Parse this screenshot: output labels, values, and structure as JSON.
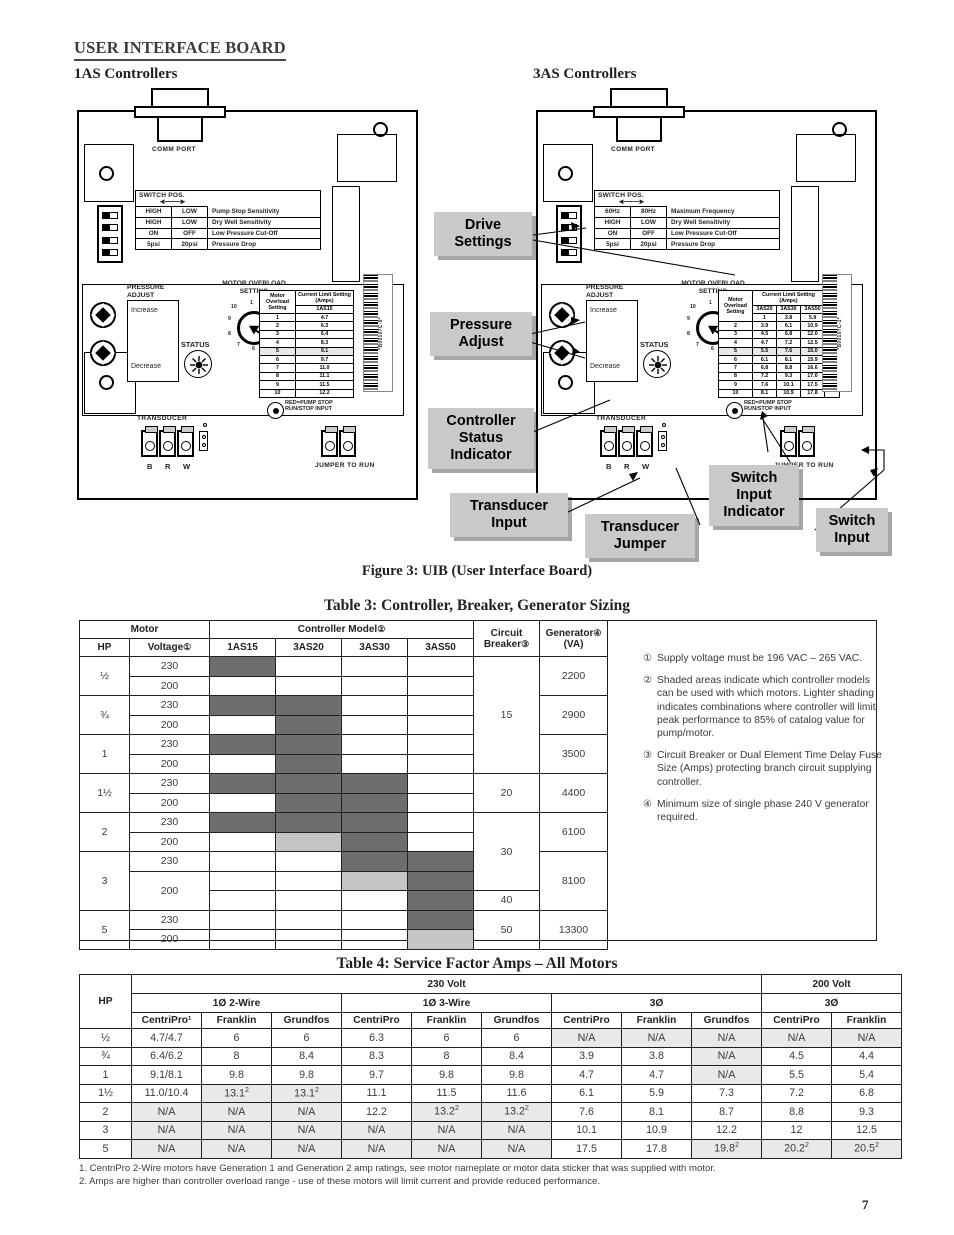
{
  "section": {
    "title": "USER INTERFACE BOARD"
  },
  "boards": {
    "left": {
      "title": "1AS Controllers",
      "comm_port": "COMM PORT",
      "switch_pos_header": "SWITCH POS.",
      "switch_rows": [
        {
          "pos_a": "HIGH",
          "pos_b": "LOW",
          "function": "Pump Stop Sensitivity"
        },
        {
          "pos_a": "HIGH",
          "pos_b": "LOW",
          "function": "Dry Well Sensitivity"
        },
        {
          "pos_a": "ON",
          "pos_b": "OFF",
          "function": "Low Pressure Cut-Off"
        },
        {
          "pos_a": "5psi",
          "pos_b": "20psi",
          "function": "Pressure Drop"
        }
      ],
      "pressure_adjust_label": "PRESSURE ADJUST",
      "increase": "Increase",
      "decrease": "Decrease",
      "status_label": "STATUS",
      "motor_overload_label": "MOTOR OVERLOAD SETTING",
      "dial_numbers": [
        "1",
        "2",
        "3",
        "4",
        "5",
        "6",
        "7",
        "8",
        "9",
        "10"
      ],
      "overload_table": {
        "col1_header": "Motor Overload Setting",
        "col2_header": "Current Limit Setting (Amps)",
        "models": [
          "1AS15"
        ],
        "rows": [
          {
            "setting": "1",
            "values": [
              "4.7"
            ]
          },
          {
            "setting": "2",
            "values": [
              "6.3"
            ]
          },
          {
            "setting": "3",
            "values": [
              "6.4"
            ]
          },
          {
            "setting": "4",
            "values": [
              "8.3"
            ]
          },
          {
            "setting": "5",
            "values": [
              "9.1"
            ]
          },
          {
            "setting": "6",
            "values": [
              "9.7"
            ]
          },
          {
            "setting": "7",
            "values": [
              "11.0"
            ]
          },
          {
            "setting": "8",
            "values": [
              "11.1"
            ]
          },
          {
            "setting": "9",
            "values": [
              "11.5"
            ]
          },
          {
            "setting": "10",
            "values": [
              "12.2"
            ]
          }
        ]
      },
      "barcode_text": "*B00107C-5*",
      "transducer_label": "TRANSDUCER",
      "terminals": [
        "B",
        "R",
        "W"
      ],
      "red_led_text_1": "RED=PUMP STOP",
      "red_led_text_2": "RUN/STOP INPUT",
      "jumper_label": "JUMPER TO RUN"
    },
    "right": {
      "title": "3AS Controllers",
      "comm_port": "COMM PORT",
      "switch_pos_header": "SWITCH POS.",
      "switch_rows": [
        {
          "pos_a": "60Hz",
          "pos_b": "80Hz",
          "function": "Maximum Frequency"
        },
        {
          "pos_a": "HIGH",
          "pos_b": "LOW",
          "function": "Dry Well Sensitivity"
        },
        {
          "pos_a": "ON",
          "pos_b": "OFF",
          "function": "Low Pressure Cut-Off"
        },
        {
          "pos_a": "5psi",
          "pos_b": "20psi",
          "function": "Pressure Drop"
        }
      ],
      "pressure_adjust_label": "PRESSURE ADJUST",
      "increase": "Increase",
      "decrease": "Decrease",
      "status_label": "STATUS",
      "motor_overload_label": "MOTOR OVERLOAD SETTING",
      "dial_numbers": [
        "1",
        "2",
        "3",
        "4",
        "5",
        "6",
        "7",
        "8",
        "9",
        "10"
      ],
      "overload_table": {
        "col1_header": "Motor Overload Setting",
        "col2_header": "Current Limit Setting (Amps)",
        "models": [
          "3AS20",
          "3AS30",
          "3AS50"
        ],
        "rows": [
          {
            "setting": "1",
            "values": [
              "3.8",
              "5.9",
              "10.1"
            ]
          },
          {
            "setting": "2",
            "values": [
              "3.9",
              "6.1",
              "10.9"
            ]
          },
          {
            "setting": "3",
            "values": [
              "4.5",
              "6.8",
              "12.0"
            ]
          },
          {
            "setting": "4",
            "values": [
              "4.7",
              "7.2",
              "12.5"
            ]
          },
          {
            "setting": "5",
            "values": [
              "5.5",
              "7.6",
              "15.0"
            ]
          },
          {
            "setting": "6",
            "values": [
              "6.1",
              "8.1",
              "15.9"
            ]
          },
          {
            "setting": "7",
            "values": [
              "6.8",
              "8.8",
              "16.6"
            ]
          },
          {
            "setting": "8",
            "values": [
              "7.2",
              "9.3",
              "17.0"
            ]
          },
          {
            "setting": "9",
            "values": [
              "7.6",
              "10.1",
              "17.5"
            ]
          },
          {
            "setting": "10",
            "values": [
              "8.1",
              "10.9",
              "17.8"
            ]
          }
        ]
      },
      "barcode_text": "*B00107C-1*",
      "transducer_label": "TRANSDUCER",
      "terminals": [
        "B",
        "R",
        "W"
      ],
      "red_led_text_1": "RED=PUMP STOP",
      "red_led_text_2": "RUN/STOP INPUT",
      "jumper_label": "JUMPER TO RUN"
    }
  },
  "callouts": {
    "drive_settings": "Drive\nSettings",
    "pressure_adjust": "Pressure\nAdjust",
    "controller_status_indicator": "Controller\nStatus\nIndicator",
    "transducer_input": "Transducer\nInput",
    "transducer_jumper": "Transducer\nJumper",
    "switch_input_indicator": "Switch\nInput\nIndicator",
    "switch_input": "Switch\nInput"
  },
  "figure_caption": "Figure 3: UIB (User Interface Board)",
  "table3": {
    "title": "Table 3: Controller, Breaker, Generator Sizing",
    "group_headers": {
      "motor": "Motor",
      "controller_model": "Controller Model",
      "controller_model_note": "②",
      "circuit_breaker": "Circuit Breaker",
      "circuit_breaker_note": "③",
      "generator": "Generator",
      "generator_note": "④",
      "generator_unit": "(VA)"
    },
    "sub_headers": {
      "hp": "HP",
      "voltage": "Voltage",
      "voltage_note": "①",
      "models": [
        "1AS15",
        "3AS20",
        "3AS30",
        "3AS50"
      ]
    },
    "rows": [
      {
        "hp": "½",
        "voltage": "230",
        "shading": [
          "dark",
          "none",
          "none",
          "none"
        ],
        "breaker": "15",
        "generator": "2200"
      },
      {
        "hp": "½",
        "voltage": "200",
        "shading": [
          "none",
          "none",
          "none",
          "none"
        ],
        "breaker": "",
        "generator": "2200"
      },
      {
        "hp": "¾",
        "voltage": "230",
        "shading": [
          "dark",
          "dark",
          "none",
          "none"
        ],
        "breaker": "15",
        "generator": "2900"
      },
      {
        "hp": "¾",
        "voltage": "200",
        "shading": [
          "none",
          "dark",
          "none",
          "none"
        ],
        "breaker": "",
        "generator": "2900"
      },
      {
        "hp": "1",
        "voltage": "230",
        "shading": [
          "dark",
          "dark",
          "none",
          "none"
        ],
        "breaker": "",
        "generator": "3500"
      },
      {
        "hp": "1",
        "voltage": "200",
        "shading": [
          "none",
          "dark",
          "none",
          "none"
        ],
        "breaker": "",
        "generator": "3500"
      },
      {
        "hp": "1½",
        "voltage": "230",
        "shading": [
          "dark",
          "dark",
          "dark",
          "none"
        ],
        "breaker": "20",
        "generator": "4400"
      },
      {
        "hp": "1½",
        "voltage": "200",
        "shading": [
          "none",
          "dark",
          "dark",
          "none"
        ],
        "breaker": "",
        "generator": "4400"
      },
      {
        "hp": "2",
        "voltage": "230",
        "shading": [
          "dark",
          "dark",
          "dark",
          "none"
        ],
        "breaker": "30",
        "generator": "6100"
      },
      {
        "hp": "2",
        "voltage": "200",
        "shading": [
          "none",
          "light",
          "dark",
          "none"
        ],
        "breaker": "",
        "generator": "6100"
      },
      {
        "hp": "3",
        "voltage": "230",
        "shading": [
          "none",
          "none",
          "dark",
          "dark"
        ],
        "breaker": "",
        "generator": "8100"
      },
      {
        "hp": "3",
        "voltage": "200",
        "shading": [
          "none",
          "none",
          "light",
          "dark"
        ],
        "breaker": "",
        "generator": "8100"
      },
      {
        "hp": "3",
        "voltage": "",
        "shading": [
          "none",
          "none",
          "none",
          "dark"
        ],
        "breaker": "40",
        "generator": "8100"
      },
      {
        "hp": "5",
        "voltage": "230",
        "shading": [
          "none",
          "none",
          "none",
          "dark"
        ],
        "breaker": "50",
        "generator": "13300"
      },
      {
        "hp": "5",
        "voltage": "200",
        "shading": [
          "none",
          "none",
          "none",
          "light"
        ],
        "breaker": "",
        "generator": "13300"
      }
    ],
    "notes": [
      {
        "marker": "①",
        "text": "Supply voltage must be 196 VAC – 265 VAC."
      },
      {
        "marker": "②",
        "text": "Shaded areas indicate which controller models can be used with which motors. Lighter shading indicates combinations where controller will limit peak performance to 85% of catalog value for pump/motor."
      },
      {
        "marker": "③",
        "text": "Circuit Breaker or Dual Element Time Delay Fuse Size (Amps) protecting branch circuit supplying controller."
      },
      {
        "marker": "④",
        "text": "Minimum size of single phase 240 V generator required."
      }
    ]
  },
  "table4": {
    "title": "Table 4: Service Factor Amps – All Motors",
    "hp_header": "HP",
    "volt_groups": [
      {
        "label": "230 Volt",
        "span": 9
      },
      {
        "label": "200 Volt",
        "span": 2
      }
    ],
    "phase_groups": [
      {
        "label": "1Ø 2-Wire",
        "span": 3
      },
      {
        "label": "1Ø 3-Wire",
        "span": 3
      },
      {
        "label": "3Ø",
        "span": 3
      },
      {
        "label": "3Ø",
        "span": 2
      }
    ],
    "brand_headers": [
      "CentriPro¹",
      "Franklin",
      "Grundfos",
      "CentriPro",
      "Franklin",
      "Grundfos",
      "CentriPro",
      "Franklin",
      "Grundfos",
      "CentriPro",
      "Franklin"
    ],
    "rows": [
      {
        "hp": "½",
        "values": [
          "4.7/4.7",
          "6",
          "6",
          "6.3",
          "6",
          "6",
          "N/A",
          "N/A",
          "N/A",
          "N/A",
          "N/A"
        ]
      },
      {
        "hp": "¾",
        "values": [
          "6.4/6.2",
          "8",
          "8.4",
          "8.3",
          "8",
          "8.4",
          "3.9",
          "3.8",
          "N/A",
          "4.5",
          "4.4"
        ]
      },
      {
        "hp": "1",
        "values": [
          "9.1/8.1",
          "9.8",
          "9.8",
          "9.7",
          "9.8",
          "9.8",
          "4.7",
          "4.7",
          "N/A",
          "5.5",
          "5.4"
        ]
      },
      {
        "hp": "1½",
        "values": [
          "11.0/10.4",
          "13.1²",
          "13.1²",
          "11.1",
          "11.5",
          "11.6",
          "6.1",
          "5.9",
          "7.3",
          "7.2",
          "6.8"
        ]
      },
      {
        "hp": "2",
        "values": [
          "N/A",
          "N/A",
          "N/A",
          "12.2",
          "13.2²",
          "13.2²",
          "7.6",
          "8.1",
          "8.7",
          "8.8",
          "9.3"
        ]
      },
      {
        "hp": "3",
        "values": [
          "N/A",
          "N/A",
          "N/A",
          "N/A",
          "N/A",
          "N/A",
          "10.1",
          "10.9",
          "12.2",
          "12",
          "12.5"
        ]
      },
      {
        "hp": "5",
        "values": [
          "N/A",
          "N/A",
          "N/A",
          "N/A",
          "N/A",
          "N/A",
          "17.5",
          "17.8",
          "19.8²",
          "20.2²",
          "20.5²"
        ]
      }
    ],
    "footnotes": [
      "1. CentriPro 2-Wire motors have Generation 1 and Generation 2 amp ratings, see motor nameplate or motor data sticker that was supplied with motor.",
      "2. Amps are higher than controller overload range - use of these motors will limit current and provide reduced performance."
    ]
  },
  "page_number": "7"
}
